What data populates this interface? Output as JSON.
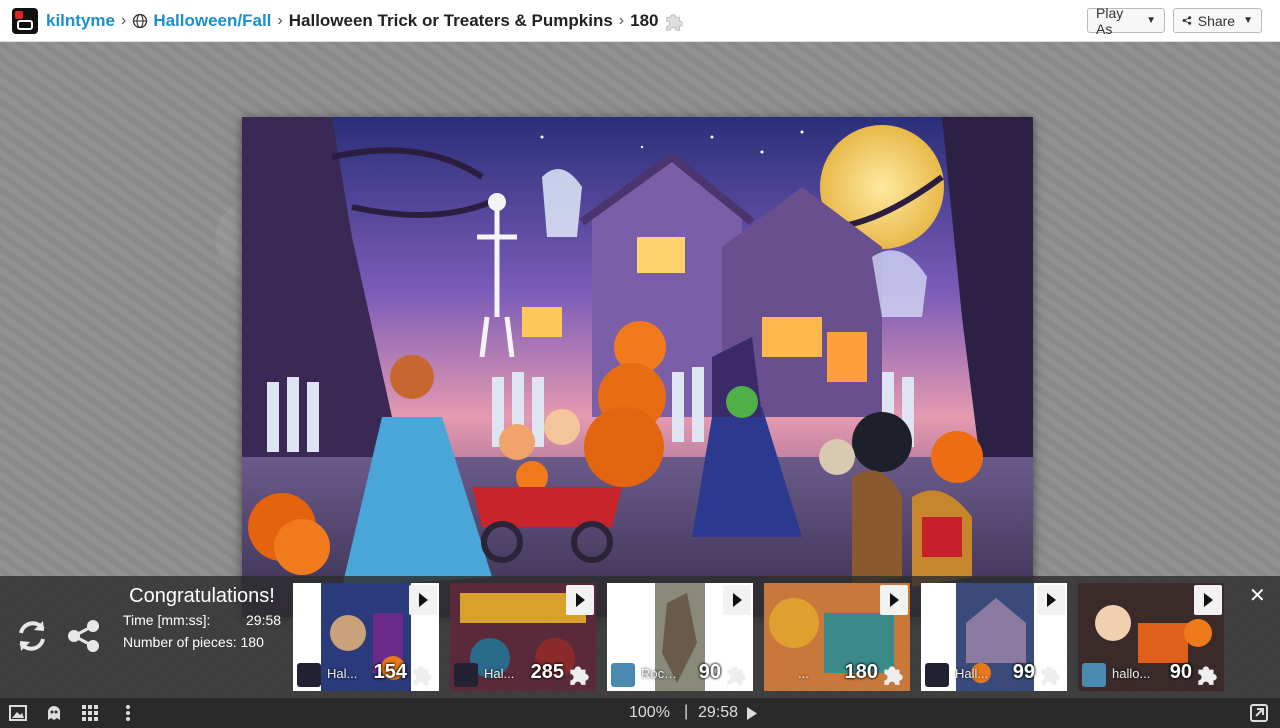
{
  "header": {
    "user": "kilntyme",
    "category": "Halloween/Fall",
    "title": "Halloween Trick or Treaters & Pumpkins",
    "pieces": "180",
    "play_as_label": "Play As",
    "share_label": "Share"
  },
  "result": {
    "heading": "Congratulations!",
    "time_label": "Time [mm:ss]:",
    "time_value": "29:58",
    "pieces_label": "Number of pieces: 180"
  },
  "thumbnails": [
    {
      "name": "Hal...",
      "count": "154"
    },
    {
      "name": "Hal...",
      "count": "285"
    },
    {
      "name": "Rock...",
      "count": "90"
    },
    {
      "name": "...",
      "count": "180"
    },
    {
      "name": "Hall...",
      "count": "99"
    },
    {
      "name": "hallo...",
      "count": "90"
    }
  ],
  "footer": {
    "zoom": "100%",
    "separator": "|",
    "timer": "29:58"
  },
  "colors": {
    "link": "#1b8fcf",
    "overlay": "#2d2d2d",
    "stage": "#8e8e8e"
  }
}
